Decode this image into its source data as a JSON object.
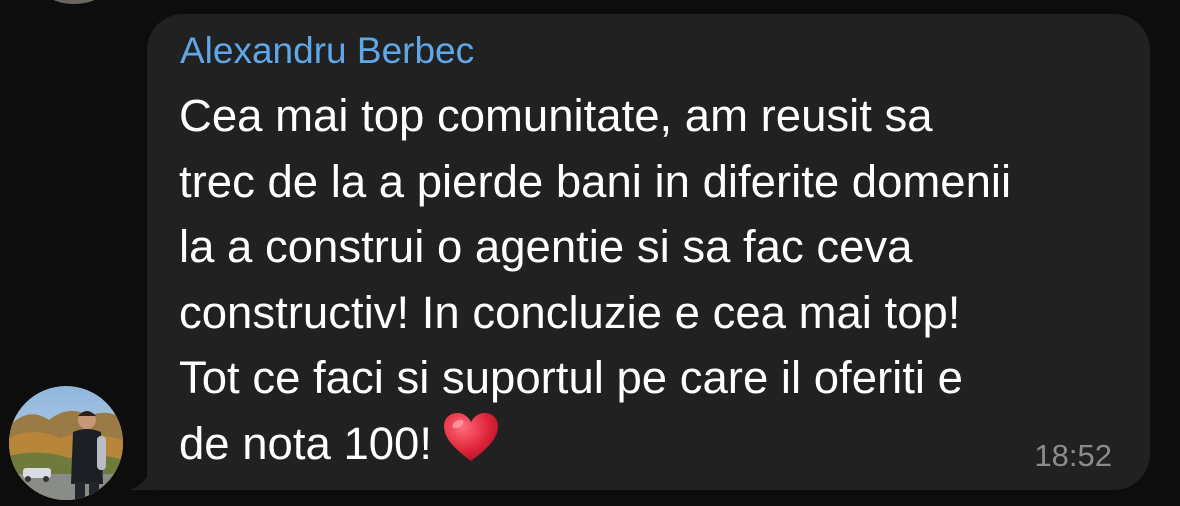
{
  "message": {
    "sender": "Alexandru Berbec",
    "lines": [
      "Cea mai top comunitate, am reusit sa",
      "trec de la a pierde bani in diferite domenii",
      "la a construi o agentie si sa fac ceva",
      "constructiv! In concluzie e cea mai top!",
      "Tot ce faci si suportul pe care il oferiti e",
      "de nota 100!"
    ],
    "emoji": "heart-icon",
    "time": "18:52"
  },
  "colors": {
    "background": "#0d0d0d",
    "bubble": "#212121",
    "sender": "#5fa7e6",
    "text": "#ffffff",
    "time": "#8b8b8b",
    "heart": "#e0243a"
  }
}
